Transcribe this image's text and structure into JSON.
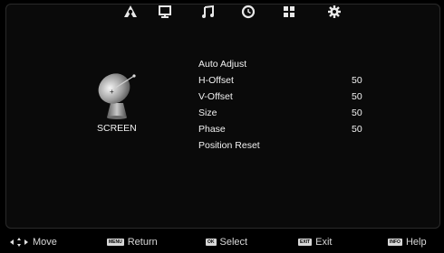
{
  "tabs": [
    {
      "icon": "satellite-icon"
    },
    {
      "icon": "monitor-icon"
    },
    {
      "icon": "music-note-icon"
    },
    {
      "icon": "clock-icon"
    },
    {
      "icon": "grid-icon"
    },
    {
      "icon": "gear-icon"
    }
  ],
  "section": {
    "label": "SCREEN",
    "icon": "satellite-dish-icon"
  },
  "menu": [
    {
      "label": "Auto Adjust",
      "value": ""
    },
    {
      "label": "H-Offset",
      "value": "50"
    },
    {
      "label": "V-Offset",
      "value": "50"
    },
    {
      "label": "Size",
      "value": "50"
    },
    {
      "label": "Phase",
      "value": "50"
    },
    {
      "label": "Position Reset",
      "value": ""
    }
  ],
  "footer": {
    "move": "Move",
    "return_key": "MENU",
    "return": "Return",
    "select_key": "OK",
    "select": "Select",
    "exit_key": "EXIT",
    "exit": "Exit",
    "help_key": "INFO",
    "help": "Help"
  }
}
